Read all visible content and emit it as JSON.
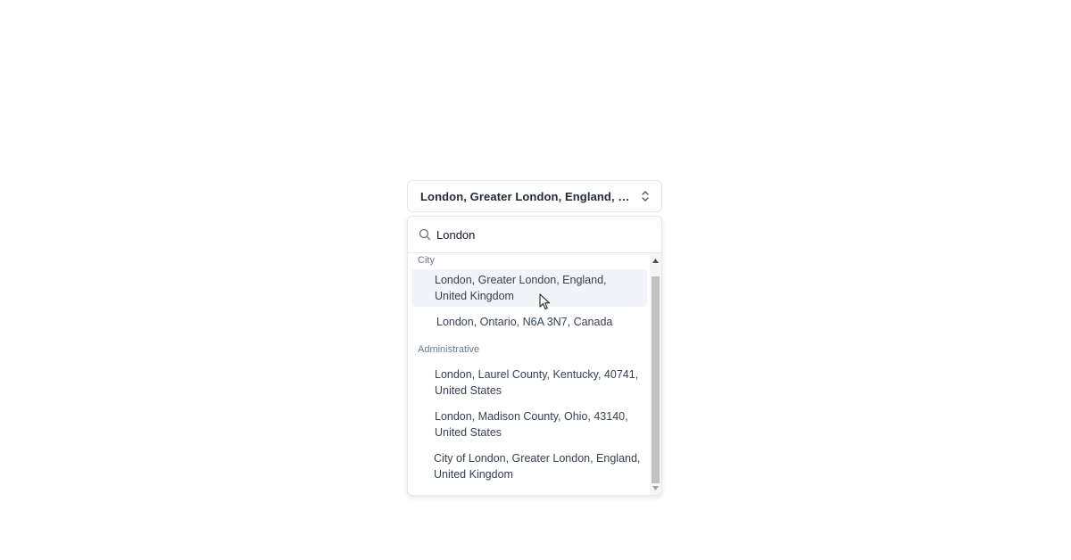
{
  "combobox": {
    "selected_label": "London, Greater London, England, United Kingdom",
    "icon": "chevron-up-down-icon"
  },
  "search": {
    "value": "London",
    "icon": "search-icon"
  },
  "groups": [
    {
      "heading": "City",
      "options": [
        "London, Greater London, England, United Kingdom",
        "London, Ontario, N6A 3N7, Canada"
      ]
    },
    {
      "heading": "Administrative",
      "options": [
        "London, Laurel County, Kentucky, 40741, United States",
        "London, Madison County, Ohio, 43140, United States",
        "City of London, Greater London, England, United Kingdom"
      ]
    }
  ],
  "colors": {
    "highlight": "#f1f4f8",
    "group_heading": "#6b7a8f",
    "border": "#e5e7eb"
  }
}
